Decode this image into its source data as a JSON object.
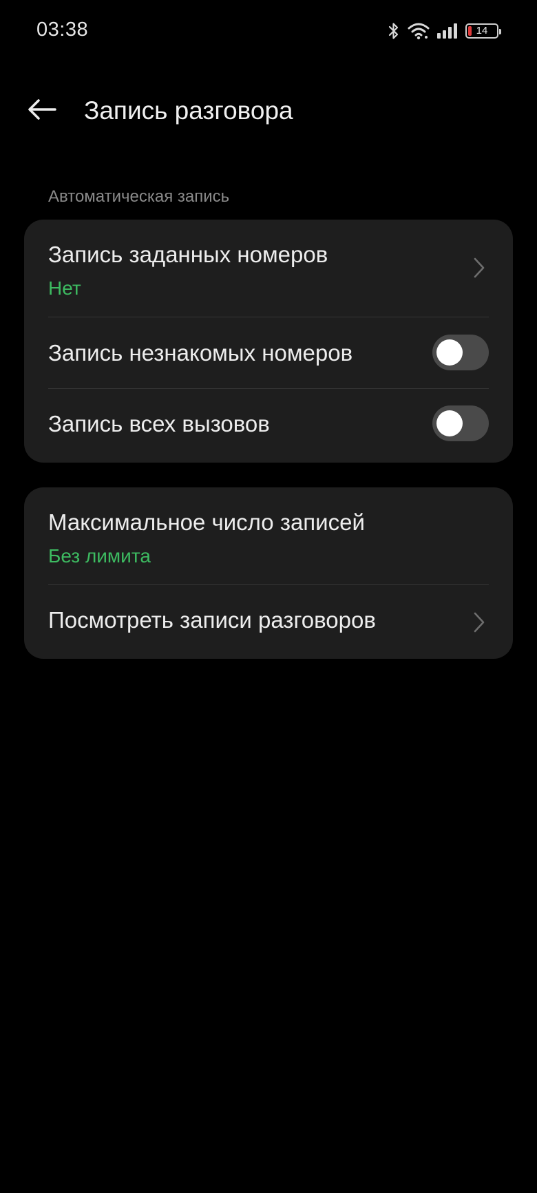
{
  "status_bar": {
    "time": "03:38",
    "icons": [
      "bluetooth-icon",
      "wifi-icon",
      "signal-icon",
      "battery-icon"
    ],
    "battery_level": "14",
    "battery_color": "#E03A3A"
  },
  "header": {
    "back_icon": "arrow-left-icon",
    "title": "Запись разговора"
  },
  "section": {
    "label": "Автоматическая запись"
  },
  "card1": {
    "specified_numbers": {
      "title": "Запись заданных номеров",
      "value": "Нет"
    },
    "unknown_numbers": {
      "title": "Запись незнакомых номеров",
      "toggle_on": false
    },
    "all_calls": {
      "title": "Запись всех вызовов",
      "toggle_on": false
    }
  },
  "card2": {
    "max_records": {
      "title": "Максимальное число записей",
      "value": "Без лимита"
    },
    "view_records": {
      "title": "Посмотреть записи разговоров"
    }
  },
  "colors": {
    "background": "#000000",
    "card": "#1E1E1E",
    "accent_green": "#3DBB61",
    "toggle_off_track": "#4A4A4A"
  }
}
